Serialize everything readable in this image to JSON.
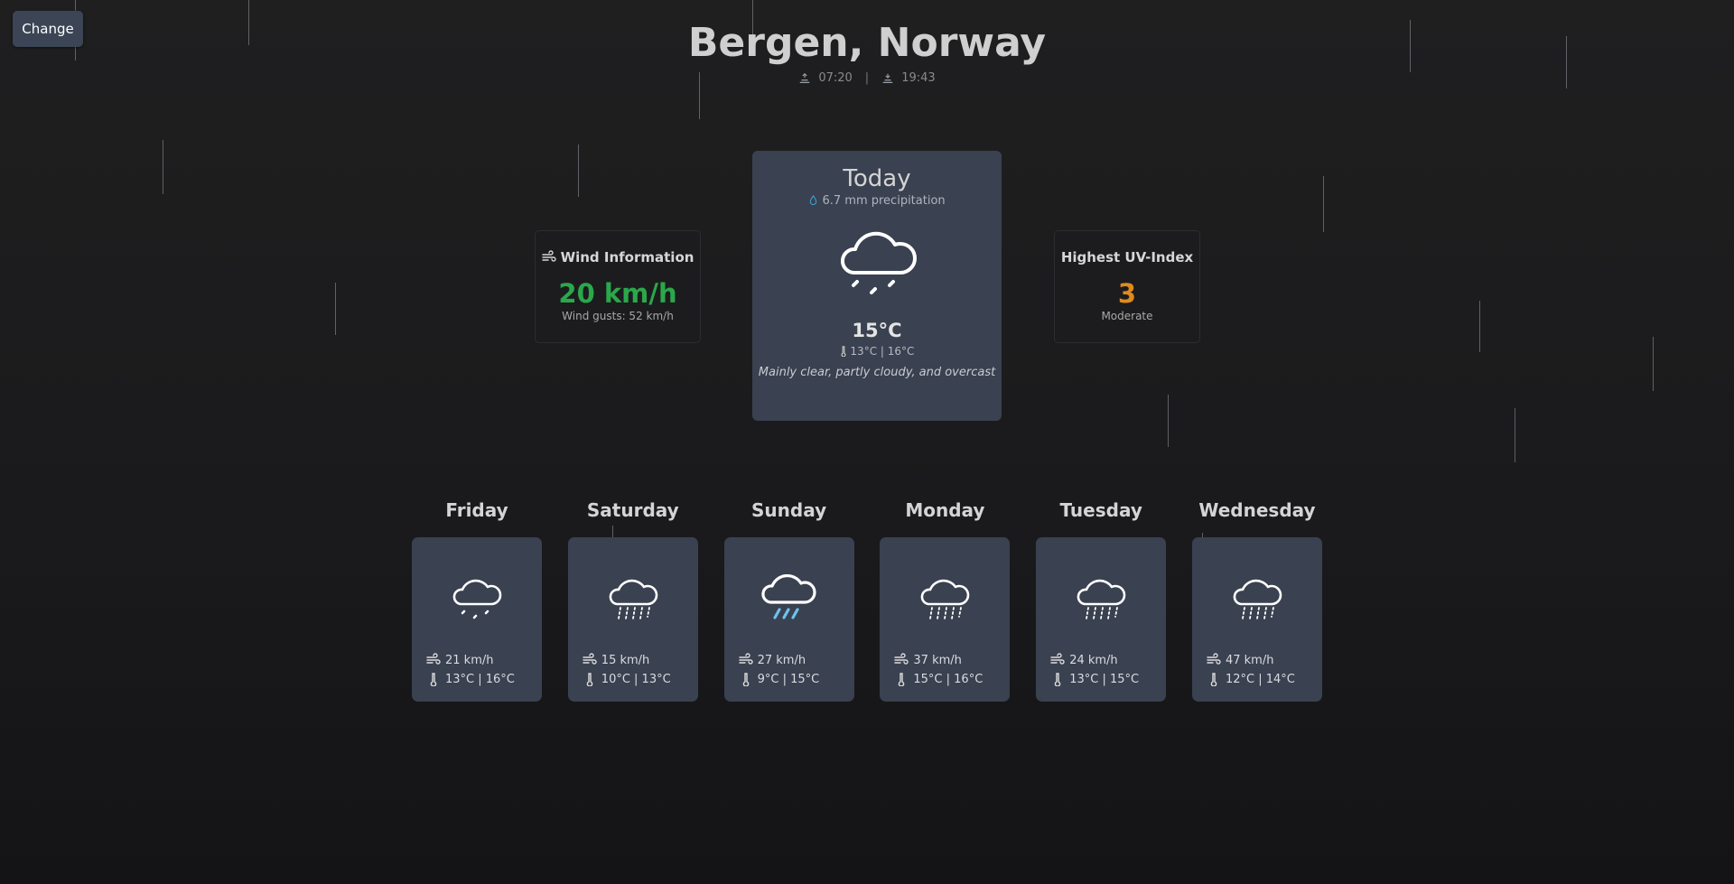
{
  "header": {
    "change_label": "Change",
    "city": "Bergen, Norway",
    "sunrise": "07:20",
    "separator": "|",
    "sunset": "19:43"
  },
  "today": {
    "title": "Today",
    "precipitation": "6.7 mm precipitation",
    "icon": "cloud-drizzle-icon",
    "temperature": "15°C",
    "range": "13°C | 16°C",
    "description": "Mainly clear, partly cloudy, and overcast"
  },
  "wind": {
    "title": "Wind Information",
    "speed": "20 km/h",
    "gusts": "Wind gusts: 52 km/h",
    "accent": "#2aa84a"
  },
  "uv": {
    "title": "Highest UV-Index",
    "value": "3",
    "level": "Moderate",
    "accent": "#e08a1e"
  },
  "forecast": [
    {
      "day": "Friday",
      "icon": "cloud-drizzle-icon",
      "wind": "21 km/h",
      "temp": "13°C | 16°C"
    },
    {
      "day": "Saturday",
      "icon": "cloud-rain-icon",
      "wind": "15 km/h",
      "temp": "10°C | 13°C"
    },
    {
      "day": "Sunday",
      "icon": "cloud-heavy-rain-icon",
      "wind": "27 km/h",
      "temp": "9°C | 15°C"
    },
    {
      "day": "Monday",
      "icon": "cloud-rain-icon",
      "wind": "37 km/h",
      "temp": "15°C | 16°C"
    },
    {
      "day": "Tuesday",
      "icon": "cloud-rain-icon",
      "wind": "24 km/h",
      "temp": "13°C | 15°C"
    },
    {
      "day": "Wednesday",
      "icon": "cloud-rain-icon",
      "wind": "47 km/h",
      "temp": "12°C | 14°C"
    }
  ]
}
